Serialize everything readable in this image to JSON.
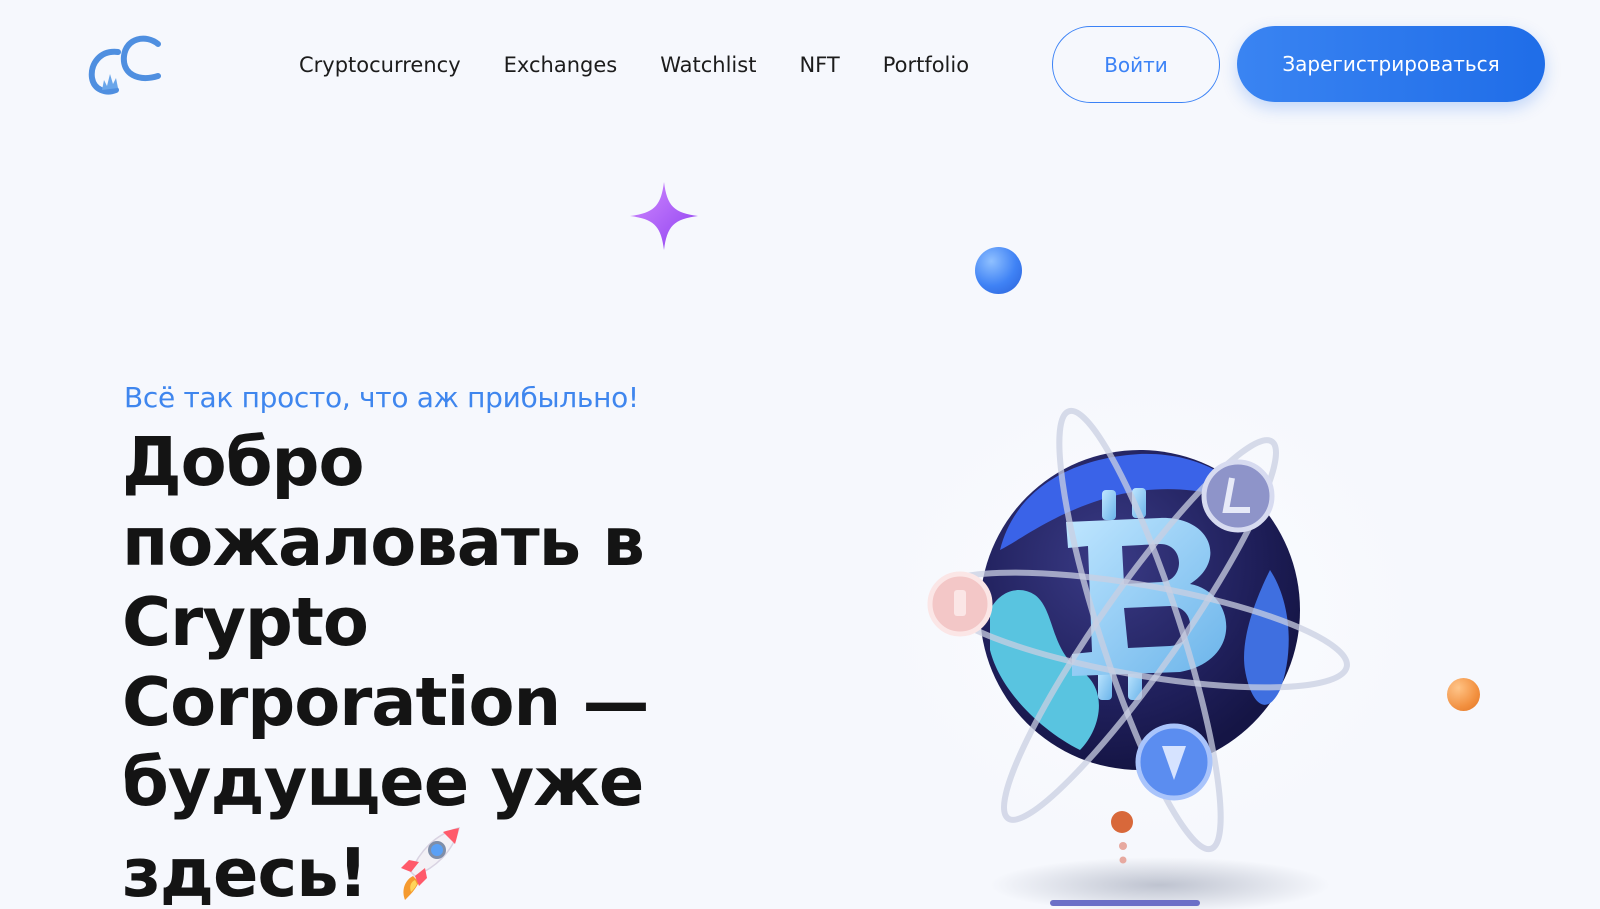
{
  "header": {
    "logo": {
      "icon": "cc-logo-icon"
    },
    "nav": [
      "Cryptocurrency",
      "Exchanges",
      "Watchlist",
      "NFT",
      "Portfolio"
    ],
    "login_label": "Войти",
    "register_label": "Зарегистрироваться"
  },
  "hero": {
    "tagline": "Всё так просто, что аж прибыльно!",
    "headline_lines": [
      "Добро",
      "пожаловать в",
      "Crypto",
      "Corporation —",
      "будущее уже",
      "здесь!"
    ],
    "headline_emoji": "rocket-icon",
    "illustration": "bitcoin-globe-icon"
  },
  "colors": {
    "accent": "#3b82f6",
    "background": "#f6f8fd",
    "text": "#141414",
    "sparkle": "#b25cf2",
    "orange_ball": "#f2903f"
  }
}
